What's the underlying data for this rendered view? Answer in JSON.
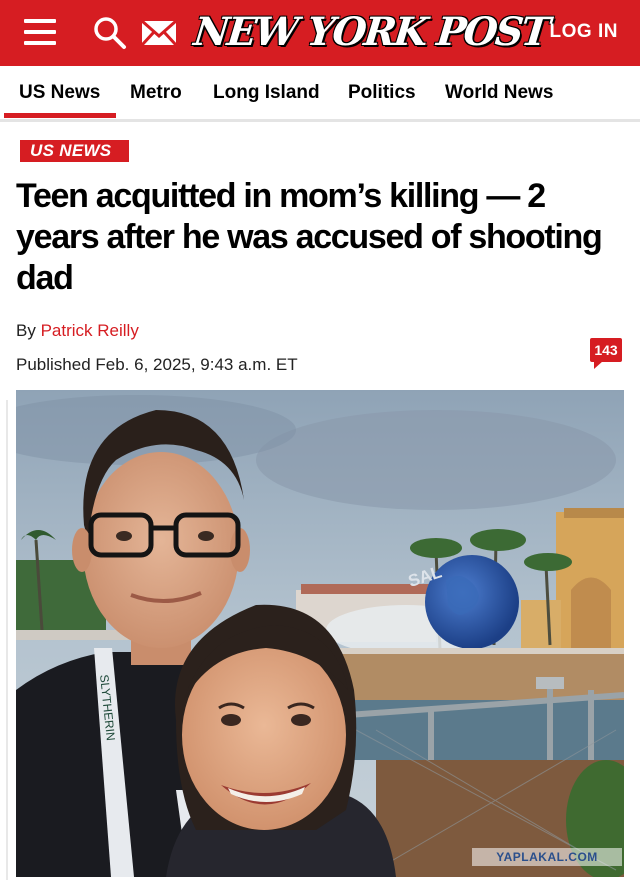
{
  "header": {
    "logo_text": "NEW YORK POST",
    "login_label": "LOG IN",
    "brand_color": "#d61d22",
    "icons": [
      "menu-icon",
      "search-icon",
      "mail-icon"
    ]
  },
  "nav": {
    "items": [
      {
        "label": "US News",
        "active": true
      },
      {
        "label": "Metro",
        "active": false
      },
      {
        "label": "Long Island",
        "active": false
      },
      {
        "label": "Politics",
        "active": false
      },
      {
        "label": "World News",
        "active": false
      }
    ]
  },
  "article": {
    "kicker": "US NEWS",
    "headline": "Teen acquitted in mom’s killing — 2 years after he was accused of shooting dad",
    "byline_prefix": "By",
    "author": "Patrick Reilly",
    "published": "Published Feb. 6, 2025, 9:43 a.m. ET",
    "comment_count": "143"
  },
  "photo": {
    "lanyard_text": "SLYTHERIN",
    "globe_text": "SAL",
    "watermark": "YAPLAKAL.COM"
  }
}
